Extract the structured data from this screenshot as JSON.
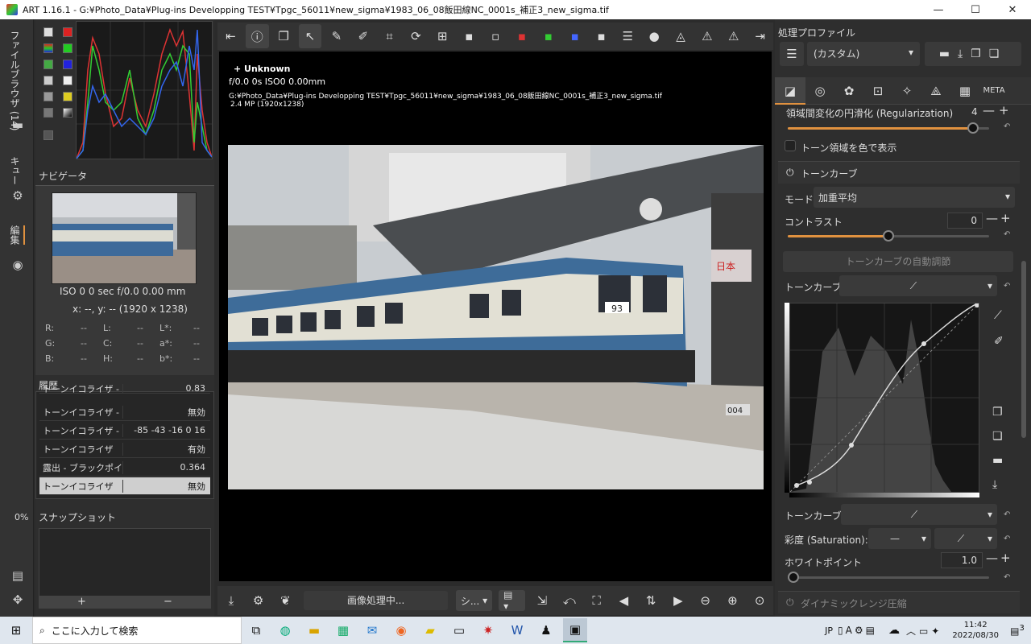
{
  "window": {
    "title": "ART 1.16.1 - G:¥Photo_Data¥Plug-ins Developping TEST¥Tpgc_56011¥new_sigma¥1983_06_08飯田線NC_0001s_補正3_new_sigma.tif",
    "min": "—",
    "max": "☐",
    "close": "✕"
  },
  "vtabs": {
    "file_browser": "ファイルブラウザ (14)",
    "queue": "キュー",
    "edit": "編集",
    "percent": "0%"
  },
  "navigator": {
    "title": "ナビゲータ",
    "exif": "ISO 0    0 sec   f/0.0   0.00 mm",
    "coords": "x: --, y: --     (1920 x 1238)",
    "labels": [
      "R:",
      "G:",
      "B:",
      "L:",
      "C:",
      "H:",
      "L*:",
      "a*:",
      "b*:"
    ],
    "values": [
      "--",
      "--",
      "--",
      "--",
      "--",
      "--",
      "--",
      "--",
      "--"
    ]
  },
  "history": {
    "title": "履歴",
    "rows": [
      {
        "name": "トーンイコライザ - ...",
        "value": "0.83"
      },
      {
        "name": "トーンイコライザ - ...",
        "value": "無効"
      },
      {
        "name": "トーンイコライザ - ...",
        "value": "-85 -43 -16 0 16"
      },
      {
        "name": "トーンイコライザ",
        "value": "有効"
      },
      {
        "name": "露出 - ブラックポイ...",
        "value": "0.364"
      },
      {
        "name": "トーンイコライザ",
        "value": "無効"
      }
    ]
  },
  "snapshot": {
    "title": "スナップショット",
    "add": "+",
    "remove": "−"
  },
  "viewer": {
    "line1": "+ Unknown",
    "line2": "f/0.0  0s  ISO0  0.00mm",
    "line3": "G:¥Photo_Data¥Plug-ins Developping TEST¥Tpgc_56011¥new_sigma¥1983_06_08飯田線NC_0001s_補正3_new_sigma.tif",
    "line4": "2.4 MP (1920x1238)",
    "train_number": "93",
    "sign": "日本",
    "platform_num": "004"
  },
  "bottom": {
    "status": "画像処理中...",
    "mode": "シ..."
  },
  "right": {
    "profile_title": "処理プロファイル",
    "profile_value": "(カスタム)",
    "reg_label": "領域間変化の円滑化 (Regularization)",
    "reg_value": "4",
    "reg_fraction": 0.92,
    "show_tone_label": "トーン領域を色で表示",
    "tonecurve_title": "トーンカーブ",
    "mode_label": "モード:",
    "mode_value": "加重平均",
    "contrast_label": "コントラスト",
    "contrast_value": "0",
    "contrast_fraction": 0.5,
    "auto_button": "トーンカーブの自動調節",
    "curve1_label": "トーンカーブ1:",
    "curve2_label": "トーンカーブ2:",
    "sat_label": "彩度 (Saturation):",
    "wp_label": "ホワイトポイント",
    "wp_value": "1.0",
    "drc_title": "ダイナミックレンジ圧縮"
  },
  "taskbar": {
    "search": "ここに入力して検索",
    "time": "11:42",
    "date": "2022/08/30",
    "lang": "JP",
    "notif": "3"
  }
}
